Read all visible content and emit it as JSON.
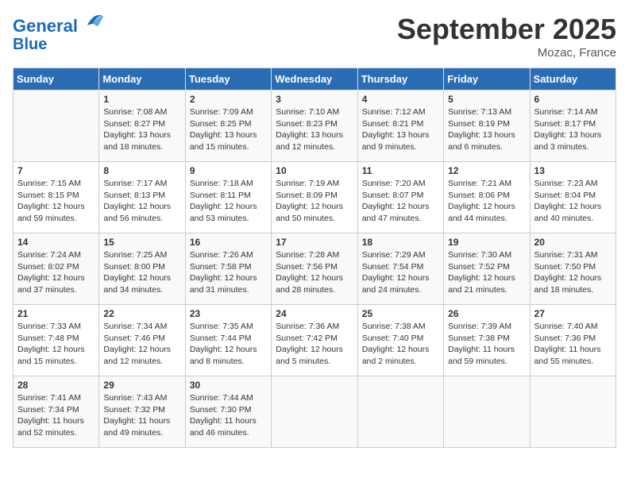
{
  "header": {
    "logo_line1": "General",
    "logo_line2": "Blue",
    "month": "September 2025",
    "location": "Mozac, France"
  },
  "days_of_week": [
    "Sunday",
    "Monday",
    "Tuesday",
    "Wednesday",
    "Thursday",
    "Friday",
    "Saturday"
  ],
  "weeks": [
    [
      {
        "day": "",
        "content": ""
      },
      {
        "day": "1",
        "content": "Sunrise: 7:08 AM\nSunset: 8:27 PM\nDaylight: 13 hours\nand 18 minutes."
      },
      {
        "day": "2",
        "content": "Sunrise: 7:09 AM\nSunset: 8:25 PM\nDaylight: 13 hours\nand 15 minutes."
      },
      {
        "day": "3",
        "content": "Sunrise: 7:10 AM\nSunset: 8:23 PM\nDaylight: 13 hours\nand 12 minutes."
      },
      {
        "day": "4",
        "content": "Sunrise: 7:12 AM\nSunset: 8:21 PM\nDaylight: 13 hours\nand 9 minutes."
      },
      {
        "day": "5",
        "content": "Sunrise: 7:13 AM\nSunset: 8:19 PM\nDaylight: 13 hours\nand 6 minutes."
      },
      {
        "day": "6",
        "content": "Sunrise: 7:14 AM\nSunset: 8:17 PM\nDaylight: 13 hours\nand 3 minutes."
      }
    ],
    [
      {
        "day": "7",
        "content": "Sunrise: 7:15 AM\nSunset: 8:15 PM\nDaylight: 12 hours\nand 59 minutes."
      },
      {
        "day": "8",
        "content": "Sunrise: 7:17 AM\nSunset: 8:13 PM\nDaylight: 12 hours\nand 56 minutes."
      },
      {
        "day": "9",
        "content": "Sunrise: 7:18 AM\nSunset: 8:11 PM\nDaylight: 12 hours\nand 53 minutes."
      },
      {
        "day": "10",
        "content": "Sunrise: 7:19 AM\nSunset: 8:09 PM\nDaylight: 12 hours\nand 50 minutes."
      },
      {
        "day": "11",
        "content": "Sunrise: 7:20 AM\nSunset: 8:07 PM\nDaylight: 12 hours\nand 47 minutes."
      },
      {
        "day": "12",
        "content": "Sunrise: 7:21 AM\nSunset: 8:06 PM\nDaylight: 12 hours\nand 44 minutes."
      },
      {
        "day": "13",
        "content": "Sunrise: 7:23 AM\nSunset: 8:04 PM\nDaylight: 12 hours\nand 40 minutes."
      }
    ],
    [
      {
        "day": "14",
        "content": "Sunrise: 7:24 AM\nSunset: 8:02 PM\nDaylight: 12 hours\nand 37 minutes."
      },
      {
        "day": "15",
        "content": "Sunrise: 7:25 AM\nSunset: 8:00 PM\nDaylight: 12 hours\nand 34 minutes."
      },
      {
        "day": "16",
        "content": "Sunrise: 7:26 AM\nSunset: 7:58 PM\nDaylight: 12 hours\nand 31 minutes."
      },
      {
        "day": "17",
        "content": "Sunrise: 7:28 AM\nSunset: 7:56 PM\nDaylight: 12 hours\nand 28 minutes."
      },
      {
        "day": "18",
        "content": "Sunrise: 7:29 AM\nSunset: 7:54 PM\nDaylight: 12 hours\nand 24 minutes."
      },
      {
        "day": "19",
        "content": "Sunrise: 7:30 AM\nSunset: 7:52 PM\nDaylight: 12 hours\nand 21 minutes."
      },
      {
        "day": "20",
        "content": "Sunrise: 7:31 AM\nSunset: 7:50 PM\nDaylight: 12 hours\nand 18 minutes."
      }
    ],
    [
      {
        "day": "21",
        "content": "Sunrise: 7:33 AM\nSunset: 7:48 PM\nDaylight: 12 hours\nand 15 minutes."
      },
      {
        "day": "22",
        "content": "Sunrise: 7:34 AM\nSunset: 7:46 PM\nDaylight: 12 hours\nand 12 minutes."
      },
      {
        "day": "23",
        "content": "Sunrise: 7:35 AM\nSunset: 7:44 PM\nDaylight: 12 hours\nand 8 minutes."
      },
      {
        "day": "24",
        "content": "Sunrise: 7:36 AM\nSunset: 7:42 PM\nDaylight: 12 hours\nand 5 minutes."
      },
      {
        "day": "25",
        "content": "Sunrise: 7:38 AM\nSunset: 7:40 PM\nDaylight: 12 hours\nand 2 minutes."
      },
      {
        "day": "26",
        "content": "Sunrise: 7:39 AM\nSunset: 7:38 PM\nDaylight: 11 hours\nand 59 minutes."
      },
      {
        "day": "27",
        "content": "Sunrise: 7:40 AM\nSunset: 7:36 PM\nDaylight: 11 hours\nand 55 minutes."
      }
    ],
    [
      {
        "day": "28",
        "content": "Sunrise: 7:41 AM\nSunset: 7:34 PM\nDaylight: 11 hours\nand 52 minutes."
      },
      {
        "day": "29",
        "content": "Sunrise: 7:43 AM\nSunset: 7:32 PM\nDaylight: 11 hours\nand 49 minutes."
      },
      {
        "day": "30",
        "content": "Sunrise: 7:44 AM\nSunset: 7:30 PM\nDaylight: 11 hours\nand 46 minutes."
      },
      {
        "day": "",
        "content": ""
      },
      {
        "day": "",
        "content": ""
      },
      {
        "day": "",
        "content": ""
      },
      {
        "day": "",
        "content": ""
      }
    ]
  ]
}
